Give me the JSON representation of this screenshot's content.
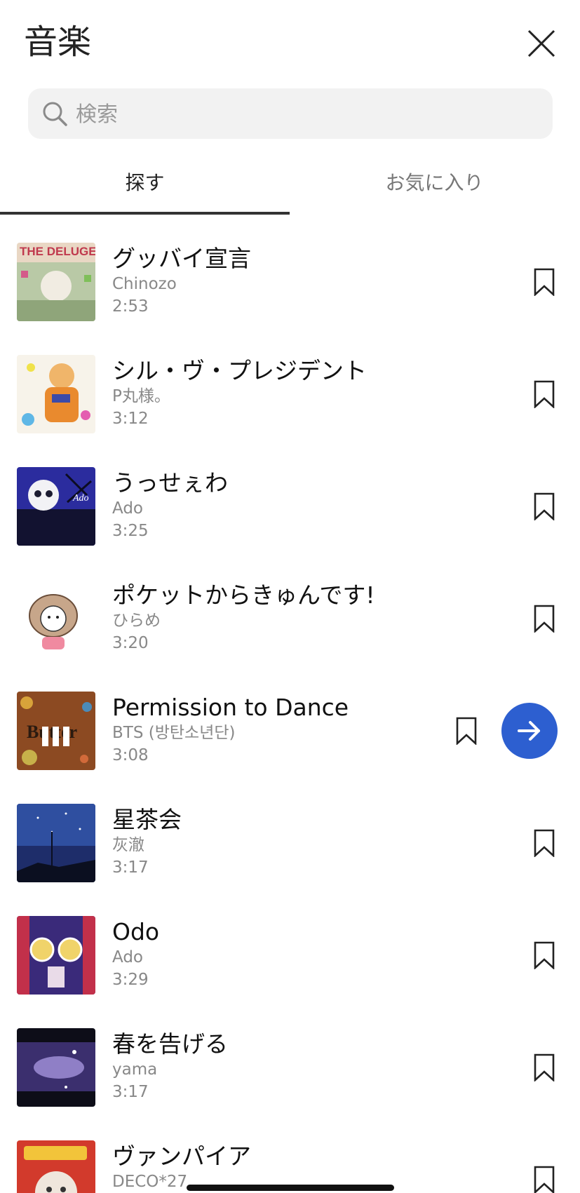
{
  "header": {
    "title": "音楽",
    "close_icon": "close-icon"
  },
  "search": {
    "placeholder": "検索",
    "value": "",
    "icon": "search-icon"
  },
  "tabs": [
    {
      "label": "探す",
      "active": true
    },
    {
      "label": "お気に入り",
      "active": false
    }
  ],
  "songs": [
    {
      "title": "グッバイ宣言",
      "artist": "Chinozo",
      "duration": "2:53",
      "cover_text": "THE DELUGE"
    },
    {
      "title": "シル・ヴ・プレジデント",
      "artist": "P丸様。",
      "duration": "3:12"
    },
    {
      "title": "うっせぇわ",
      "artist": "Ado",
      "duration": "3:25",
      "cover_text": "Ado"
    },
    {
      "title": "ポケットからきゅんです!",
      "artist": "ひらめ",
      "duration": "3:20"
    },
    {
      "title": "Permission to Dance",
      "artist": "BTS (방탄소년단)",
      "duration": "3:08",
      "playing": true,
      "cover_text": "Butter"
    },
    {
      "title": "星茶会",
      "artist": "灰澈",
      "duration": "3:17"
    },
    {
      "title": "Odo",
      "artist": "Ado",
      "duration": "3:29"
    },
    {
      "title": "春を告げる",
      "artist": "yama",
      "duration": "3:17"
    },
    {
      "title": "ヴァンパイア",
      "artist": "DECO*27",
      "duration": ""
    }
  ],
  "colors": {
    "accent": "#2d5fd0",
    "tab_indicator": "#333333",
    "search_bg": "#f2f2f2",
    "secondary_text": "#888888"
  }
}
